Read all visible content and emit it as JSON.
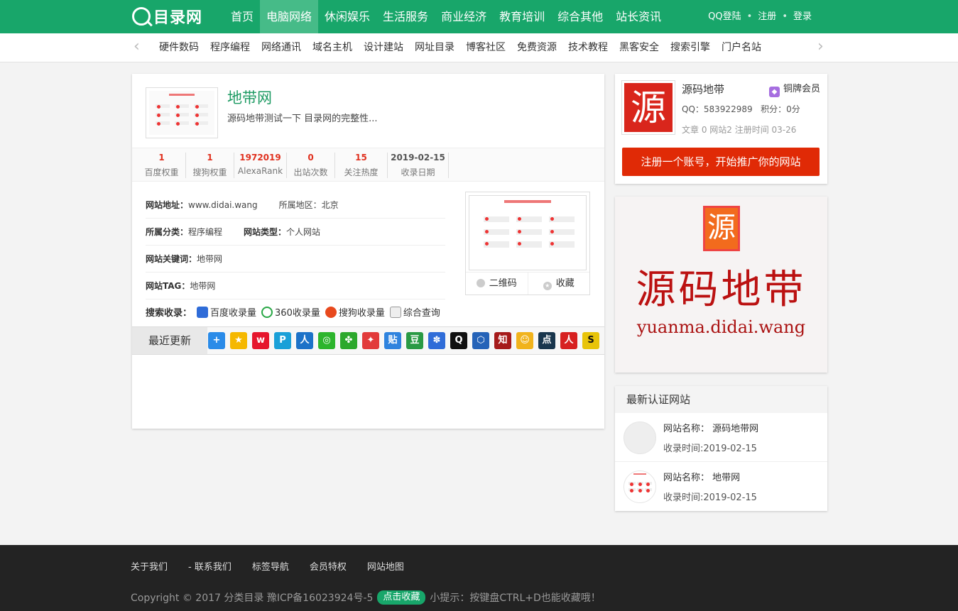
{
  "header": {
    "logo_text": "目录网",
    "nav": [
      "首页",
      "电脑网络",
      "休闲娱乐",
      "生活服务",
      "商业经济",
      "教育培训",
      "综合其他",
      "站长资讯"
    ],
    "nav_active": 1,
    "user": {
      "qq_login": "QQ登陆",
      "register": "注册",
      "login": "登录"
    }
  },
  "subnav": [
    "硬件数码",
    "程序编程",
    "网络通讯",
    "域名主机",
    "设计建站",
    "网址目录",
    "博客社区",
    "免费资源",
    "技术教程",
    "黑客安全",
    "搜索引擎",
    "门户名站"
  ],
  "site": {
    "title": "地带网",
    "description": "源码地带测试一下 目录网的完整性...",
    "stats": [
      {
        "value": "1",
        "label": "百度权重"
      },
      {
        "value": "1",
        "label": "搜狗权重"
      },
      {
        "value": "1972019",
        "label": "AlexaRank"
      },
      {
        "value": "0",
        "label": "出站次数"
      },
      {
        "value": "15",
        "label": "关注热度"
      },
      {
        "value": "2019-02-15",
        "label": "收录日期"
      }
    ],
    "info": {
      "url_label": "网站地址：",
      "url": "www.didai.wang",
      "region_label": "所属地区：",
      "region": "北京",
      "category_label": "所属分类：",
      "category": "程序编程",
      "type_label": "网站类型：",
      "type": "个人网站",
      "keywords_label": "网站关键词：",
      "keywords": "地带网",
      "tag_label": "网站TAG：",
      "tag": "地带网"
    },
    "preview": {
      "qrcode": "二维码",
      "favorite": "收藏"
    },
    "search": {
      "label": "搜索收录：",
      "items": [
        "百度收录量",
        "360收录量",
        "搜狗收录量",
        "综合查询"
      ]
    },
    "recent_label": "最近更新"
  },
  "profile": {
    "avatar_char": "源",
    "name": "源码地带",
    "badge": "铜牌会员",
    "qq": "QQ：583922989",
    "points": "积分：0分",
    "meta": "文章 0  网站2  注册时间 03-26",
    "cta": "注册一个账号，开始推广你的网站"
  },
  "banner": {
    "seal": "源",
    "title": "源码地带",
    "url": "yuanma.didai.wang"
  },
  "latest": {
    "title": "最新认证网站",
    "items": [
      {
        "name": "网站名称： 源码地带网",
        "time": "收录时间:2019-02-15"
      },
      {
        "name": "网站名称： 地带网",
        "time": "收录时间:2019-02-15"
      }
    ]
  },
  "footer": {
    "links": [
      "关于我们",
      "- 联系我们",
      "标签导航",
      "会员特权",
      "网站地图"
    ],
    "copyright": "Copyright © 2017 分类目录  豫ICP备16023924号-5",
    "fav_button": "点击收藏",
    "tip": "小提示：按键盘CTRL+D也能收藏哦！"
  },
  "colors": {
    "brand": "#18a66a",
    "accent": "#e02a06",
    "stat": "#e0301e"
  }
}
